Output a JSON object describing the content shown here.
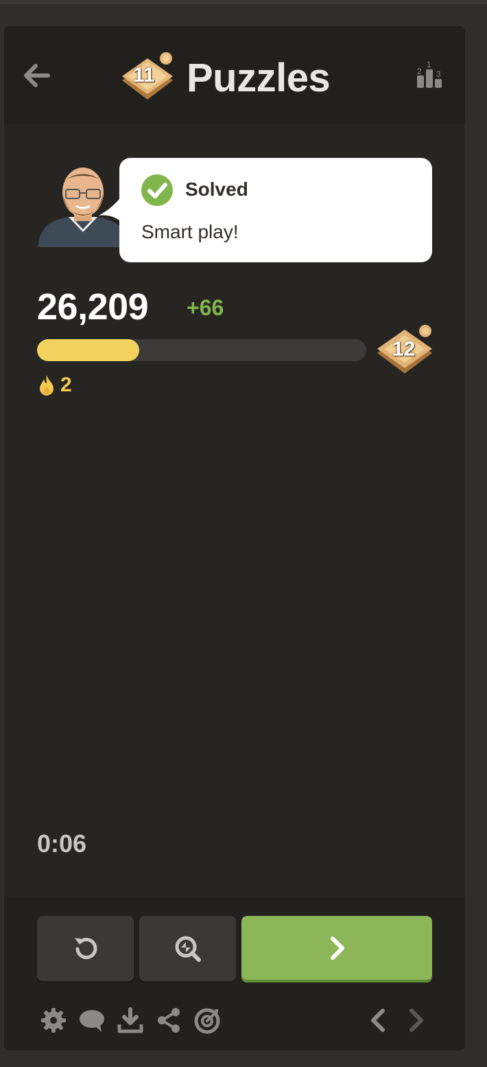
{
  "header": {
    "title": "Puzzles",
    "badge_level": "11",
    "icons": {
      "back": "arrow-left-icon",
      "leaderboard": "leaderboard-podium-icon"
    }
  },
  "coach_bubble": {
    "status": "Solved",
    "message": "Smart play!",
    "icon": "check-circle-icon",
    "check_color": "#81b64c"
  },
  "rating": {
    "score": "26,209",
    "delta": "+66",
    "progress_fraction": 0.31,
    "next_level": "12",
    "streak": "2",
    "streak_icon": "flame-icon"
  },
  "timer": "0:06",
  "actions": {
    "retry_icon": "retry-icon",
    "analyze_icon": "analysis-magnifier-icon",
    "next_icon": "chevron-right-icon"
  },
  "toolbar": {
    "icons": [
      "gear-icon",
      "chat-icon",
      "download-icon",
      "share-icon",
      "target-icon"
    ],
    "nav": [
      "chevron-left-icon",
      "chevron-right-icon"
    ]
  },
  "colors": {
    "panel": "#262522",
    "accent_green": "#81b64c",
    "progress_yellow": "#f2d25e",
    "next_button": "#8cb658"
  }
}
